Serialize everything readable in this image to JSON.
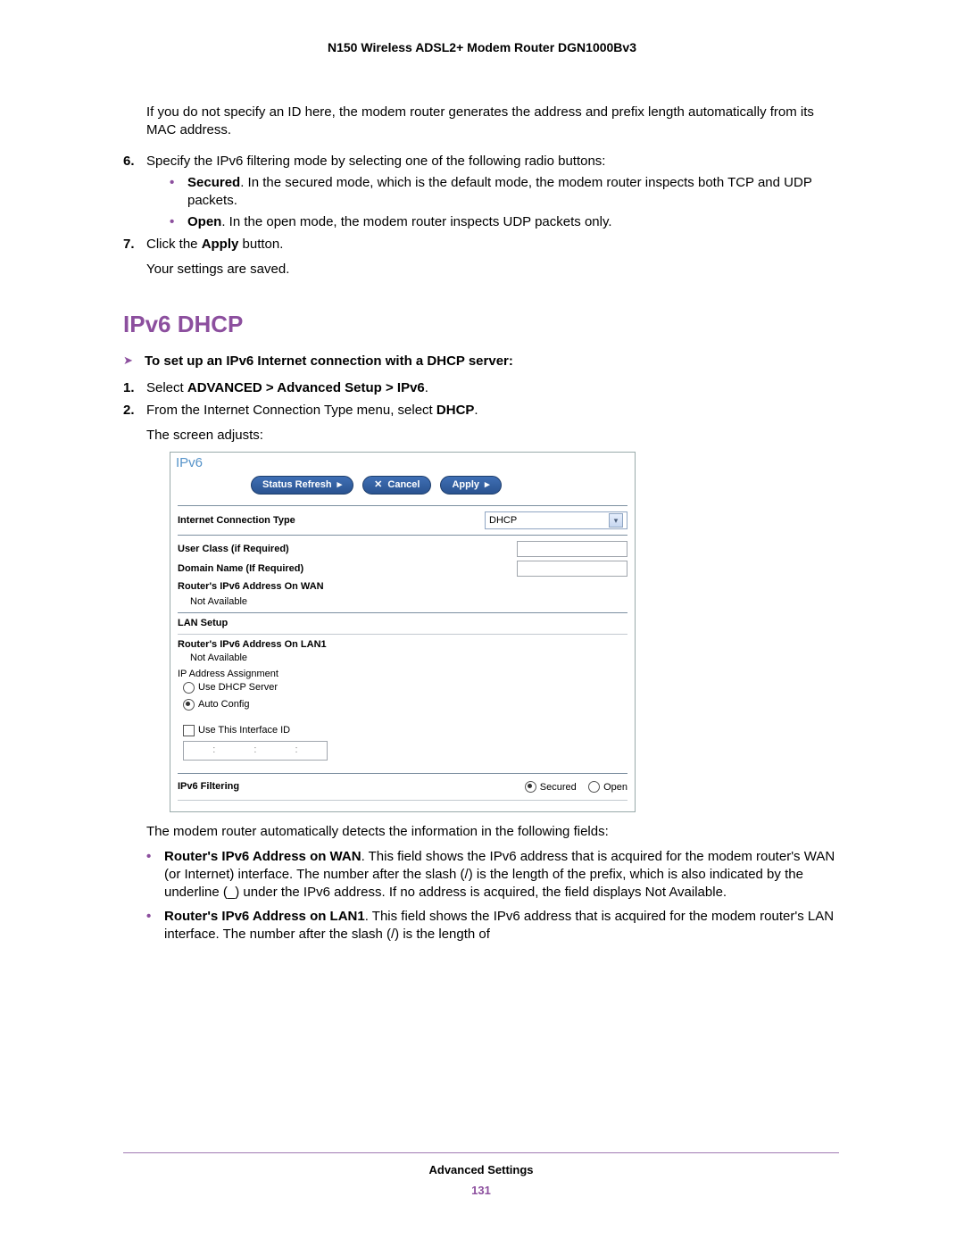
{
  "header": {
    "product_title": "N150 Wireless ADSL2+ Modem Router DGN1000Bv3"
  },
  "intro": {
    "para1": "If you do not specify an ID here, the modem router generates the address and prefix length automatically from its MAC address."
  },
  "step6": {
    "num": "6.",
    "text": "Specify the IPv6 filtering mode by selecting one of the following radio buttons:",
    "b1_label": "Secured",
    "b1_rest": ". In the secured mode, which is the default mode, the modem router inspects both TCP and UDP packets.",
    "b2_label": "Open",
    "b2_rest": ". In the open mode, the modem router inspects UDP packets only."
  },
  "step7": {
    "num": "7.",
    "pre": "Click the ",
    "bold": "Apply",
    "post": " button.",
    "after": "Your settings are saved."
  },
  "section": {
    "heading": "IPv6 DHCP",
    "proc_title": "To set up an IPv6 Internet connection with a DHCP server:"
  },
  "s1": {
    "num": "1.",
    "pre": "Select ",
    "bold": "ADVANCED > Advanced Setup > IPv6",
    "post": "."
  },
  "s2": {
    "num": "2.",
    "pre": "From the Internet Connection Type menu, select ",
    "bold": "DHCP",
    "post": ".",
    "after": "The screen adjusts:"
  },
  "shot": {
    "title": "IPv6",
    "btn_refresh": "Status Refresh",
    "btn_cancel": "Cancel",
    "btn_apply": "Apply",
    "ict_label": "Internet Connection Type",
    "ict_value": "DHCP",
    "user_class": "User Class (if Required)",
    "domain_name": "Domain Name  (If Required)",
    "wan_addr_label": "Router's IPv6 Address On WAN",
    "not_avail": "Not Available",
    "lan_setup": "LAN Setup",
    "lan1_addr_label": "Router's IPv6 Address On LAN1",
    "ip_assign": "IP Address Assignment",
    "use_dhcp": "Use DHCP Server",
    "auto_config": "Auto Config",
    "use_iface": "Use This Interface ID",
    "filtering": "IPv6 Filtering",
    "secured": "Secured",
    "open": "Open"
  },
  "after_shot": {
    "para": "The modem router automatically detects the information in the following fields:",
    "f1_label": "Router's IPv6 Address on WAN",
    "f1_rest": ". This field shows the IPv6 address that is acquired for the modem router's WAN (or Internet) interface. The number after the slash (/) is the length of the prefix, which is also indicated by the underline (_) under the IPv6 address. If no address is acquired, the field displays Not Available.",
    "f2_label": "Router's IPv6 Address on LAN1",
    "f2_rest": ". This field shows the IPv6 address that is acquired for the modem router's LAN interface. The number after the slash (/) is the length of"
  },
  "footer": {
    "section": "Advanced Settings",
    "page": "131"
  }
}
